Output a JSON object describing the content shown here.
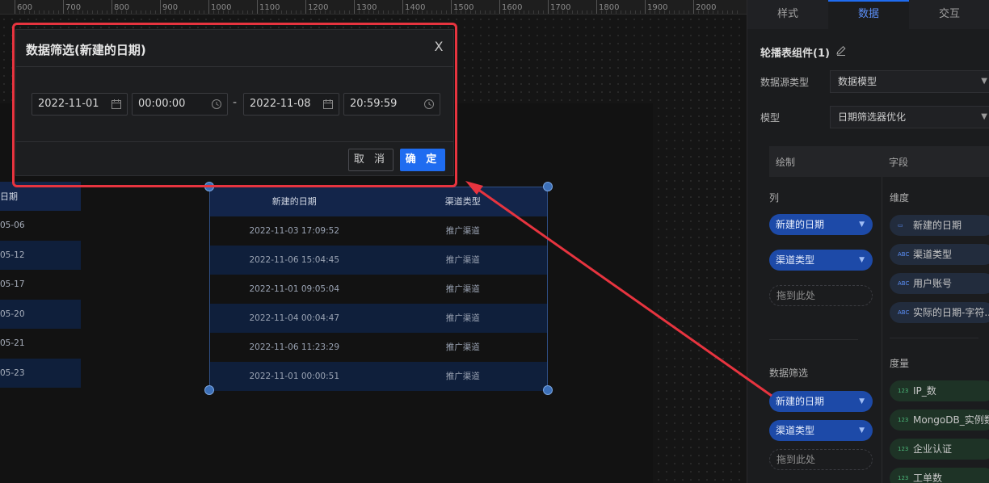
{
  "ruler": {
    "labels": [
      "600",
      "700",
      "800",
      "900",
      "1000",
      "1100",
      "1200",
      "1300",
      "1400",
      "1500",
      "1600",
      "1700",
      "1800",
      "1900",
      "2000"
    ]
  },
  "left_table": {
    "header": "日期",
    "rows": [
      "05-06",
      "05-12",
      "05-17",
      "05-20",
      "05-21",
      "05-23"
    ]
  },
  "main_table": {
    "columns": [
      "新建的日期",
      "渠道类型"
    ],
    "rows": [
      [
        "2022-11-03 17:09:52",
        "推广渠道"
      ],
      [
        "2022-11-06 15:04:45",
        "推广渠道"
      ],
      [
        "2022-11-01 09:05:04",
        "推广渠道"
      ],
      [
        "2022-11-04 00:04:47",
        "推广渠道"
      ],
      [
        "2022-11-06 11:23:29",
        "推广渠道"
      ],
      [
        "2022-11-01 00:00:51",
        "推广渠道"
      ]
    ]
  },
  "modal": {
    "title": "数据筛选(新建的日期)",
    "close": "X",
    "start_date": "2022-11-01",
    "start_time": "00:00:00",
    "separator": "-",
    "end_date": "2022-11-08",
    "end_time": "20:59:59",
    "cancel": "取 消",
    "ok": "确 定"
  },
  "panel": {
    "tabs": [
      "样式",
      "数据",
      "交互"
    ],
    "active_tab": "数据",
    "title": "轮播表组件(1)",
    "source_type_label": "数据源类型",
    "source_type_value": "数据模型",
    "model_label": "模型",
    "model_value": "日期筛选器优化",
    "subtabs": [
      "绘制",
      "字段"
    ],
    "columns_label": "列",
    "column_chips": [
      "新建的日期",
      "渠道类型"
    ],
    "drop_here": "拖到此处",
    "filter_label": "数据筛选",
    "filter_chips": [
      "新建的日期",
      "渠道类型"
    ],
    "dimension_label": "维度",
    "dimensions": [
      "新建的日期",
      "渠道类型",
      "用户账号",
      "实际的日期-字符.."
    ],
    "measure_label": "度量",
    "measures": [
      "IP_数",
      "MongoDB_实例数",
      "企业认证",
      "工单数"
    ]
  },
  "colors": {
    "accent": "#1f6cf0",
    "highlight": "#e7343f",
    "chip": "#1d4aa8"
  }
}
